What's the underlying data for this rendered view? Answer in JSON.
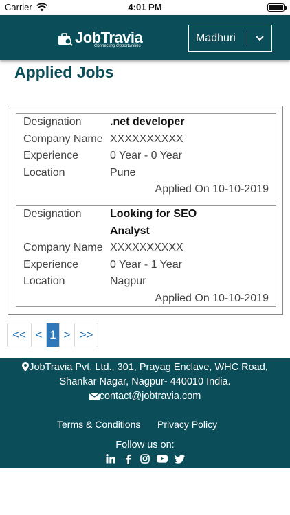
{
  "status_bar": {
    "carrier": "Carrier",
    "time": "4:01 PM"
  },
  "header": {
    "logo_text": "JobTravia",
    "logo_tagline": "Connecting Opportunities",
    "user_name": "Madhuri",
    "icons": {
      "logo": "briefcase-search-icon",
      "dropdown": "chevron-down-icon"
    }
  },
  "page_title": "Applied Jobs",
  "labels": {
    "designation": "Designation",
    "company": "Company Name",
    "experience": "Experience",
    "location": "Location"
  },
  "jobs": [
    {
      "designation": ".net developer",
      "company": "XXXXXXXXXX",
      "experience": "0 Year - 0 Year",
      "location": "Pune",
      "applied": "Applied On 10-10-2019"
    },
    {
      "designation_line1": "Looking for SEO",
      "designation_line2": "Analyst",
      "company": "XXXXXXXXXX",
      "experience": "0 Year - 1 Year",
      "location": "Nagpur",
      "applied": "Applied On 10-10-2019"
    }
  ],
  "pagination": {
    "first": "<<",
    "prev": "<",
    "current": "1",
    "next": ">",
    "last": ">>"
  },
  "footer": {
    "address_line1": "JobTravia Pvt. Ltd., 301, Prayag Enclave, WHC Road,",
    "address_line2": "Shankar Nagar, Nagpur- 440010 India.",
    "email": "contact@jobtravia.com",
    "terms": "Terms & Conditions",
    "privacy": "Privacy Policy",
    "follow": "Follow us on:",
    "socials": [
      "linkedin-icon",
      "facebook-icon",
      "instagram-icon",
      "youtube-icon",
      "twitter-icon"
    ]
  },
  "colors": {
    "brand": "#0b4e5a",
    "page_current": "#2e77b8",
    "link": "#1f6fb2"
  }
}
